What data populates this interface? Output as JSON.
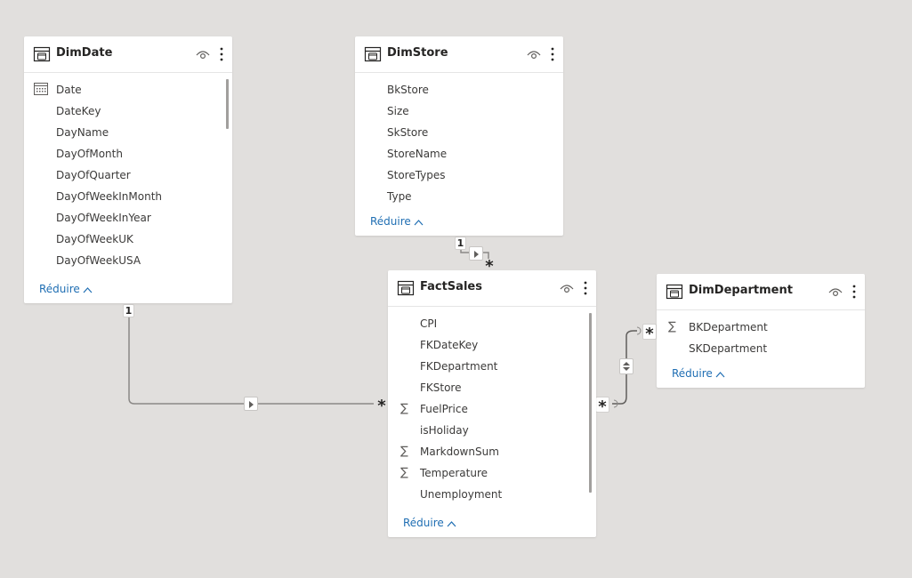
{
  "tables": {
    "dimdate": {
      "title": "DimDate",
      "fields": [
        "Date",
        "DateKey",
        "DayName",
        "DayOfMonth",
        "DayOfQuarter",
        "DayOfWeekInMonth",
        "DayOfWeekInYear",
        "DayOfWeekUK",
        "DayOfWeekUSA"
      ],
      "collapse_label": "Réduire"
    },
    "dimstore": {
      "title": "DimStore",
      "fields": [
        "BkStore",
        "Size",
        "SkStore",
        "StoreName",
        "StoreTypes",
        "Type"
      ],
      "collapse_label": "Réduire"
    },
    "factsales": {
      "title": "FactSales",
      "fields": [
        "CPI",
        "FKDateKey",
        "FKDepartment",
        "FKStore",
        "FuelPrice",
        "isHoliday",
        "MarkdownSum",
        "Temperature",
        "Unemployment"
      ],
      "collapse_label": "Réduire"
    },
    "dimdepartment": {
      "title": "DimDepartment",
      "fields": [
        "BKDepartment",
        "SKDepartment"
      ],
      "collapse_label": "Réduire"
    }
  },
  "relationships": {
    "date_sales": {
      "one": "1",
      "many": "*"
    },
    "store_sales": {
      "one": "1",
      "many": "*"
    },
    "department_sales": {
      "many_department": "*",
      "many_sales": "*"
    }
  },
  "icons": {
    "sum": "∑",
    "table": "table-icon",
    "visibility": "eye-icon",
    "more": "more-options-icon",
    "calendar": "calendar-icon",
    "chevron": "chevron-up-icon"
  },
  "colors": {
    "canvas": "#e1dfdd",
    "card": "#ffffff",
    "link": "#1f6eb3",
    "line": "#8a8886"
  }
}
